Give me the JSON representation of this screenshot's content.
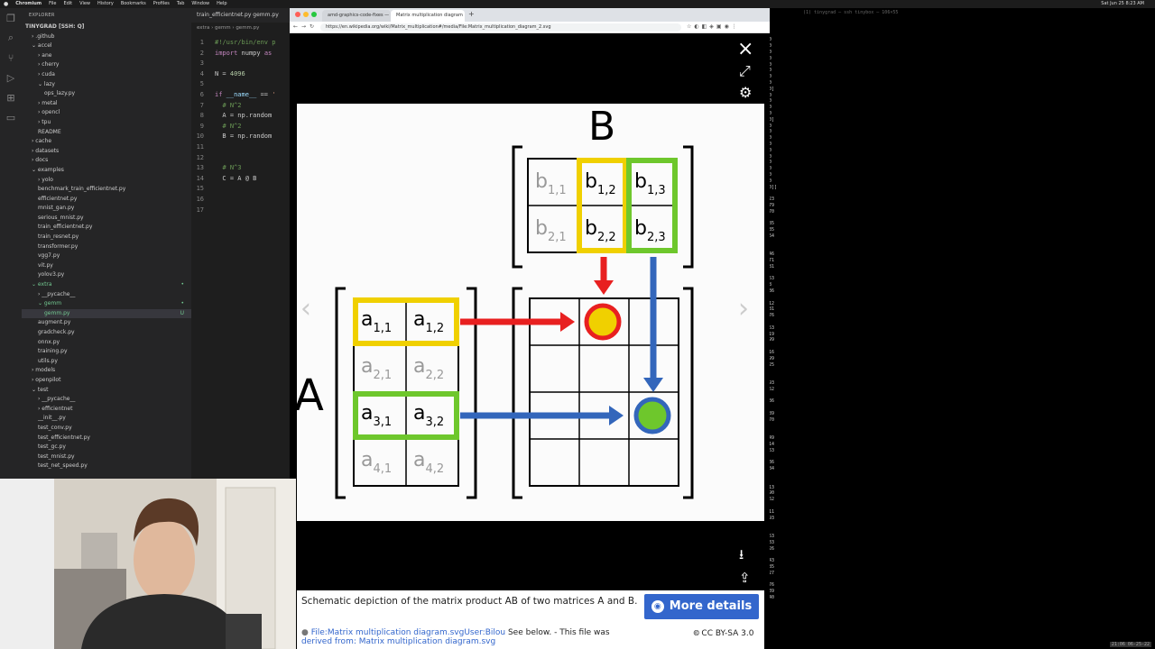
{
  "menubar": {
    "apple": "",
    "items": [
      "Chromium",
      "File",
      "Edit",
      "View",
      "History",
      "Bookmarks",
      "Profiles",
      "Tab",
      "Window",
      "Help"
    ],
    "clock": "Sat Jun 25  8:23 AM"
  },
  "explorer": {
    "header": "EXPLORER",
    "root": "TINYGRAD [SSH: Q]",
    "items": [
      {
        "label": "› .github",
        "d": 1
      },
      {
        "label": "⌄ accel",
        "d": 1
      },
      {
        "label": "› ane",
        "d": 2
      },
      {
        "label": "› cherry",
        "d": 2
      },
      {
        "label": "› cuda",
        "d": 2
      },
      {
        "label": "⌄ lazy",
        "d": 2
      },
      {
        "label": "ops_lazy.py",
        "d": 3
      },
      {
        "label": "› metal",
        "d": 2
      },
      {
        "label": "› opencl",
        "d": 2
      },
      {
        "label": "› tpu",
        "d": 2
      },
      {
        "label": "README",
        "d": 2
      },
      {
        "label": "› cache",
        "d": 1
      },
      {
        "label": "› datasets",
        "d": 1
      },
      {
        "label": "› docs",
        "d": 1
      },
      {
        "label": "⌄ examples",
        "d": 1
      },
      {
        "label": "› yolo",
        "d": 2
      },
      {
        "label": "benchmark_train_efficientnet.py",
        "d": 2
      },
      {
        "label": "efficientnet.py",
        "d": 2
      },
      {
        "label": "mnist_gan.py",
        "d": 2
      },
      {
        "label": "serious_mnist.py",
        "d": 2
      },
      {
        "label": "train_efficientnet.py",
        "d": 2
      },
      {
        "label": "train_resnet.py",
        "d": 2
      },
      {
        "label": "transformer.py",
        "d": 2
      },
      {
        "label": "vgg7.py",
        "d": 2
      },
      {
        "label": "vit.py",
        "d": 2
      },
      {
        "label": "yolov3.py",
        "d": 2
      },
      {
        "label": "⌄ extra",
        "d": 1,
        "badge": "•"
      },
      {
        "label": "› __pycache__",
        "d": 2
      },
      {
        "label": "⌄ gemm",
        "d": 2,
        "badge": "•"
      },
      {
        "label": "gemm.py",
        "d": 3,
        "badge": "U",
        "sel": true
      },
      {
        "label": "augment.py",
        "d": 2
      },
      {
        "label": "gradcheck.py",
        "d": 2
      },
      {
        "label": "onnx.py",
        "d": 2
      },
      {
        "label": "training.py",
        "d": 2
      },
      {
        "label": "utils.py",
        "d": 2
      },
      {
        "label": "› models",
        "d": 1
      },
      {
        "label": "› openpilot",
        "d": 1
      },
      {
        "label": "⌄ test",
        "d": 1
      },
      {
        "label": "› __pycache__",
        "d": 2
      },
      {
        "label": "› efficientnet",
        "d": 2
      },
      {
        "label": "__init__.py",
        "d": 2
      },
      {
        "label": "test_conv.py",
        "d": 2
      },
      {
        "label": "test_efficientnet.py",
        "d": 2
      },
      {
        "label": "test_gc.py",
        "d": 2
      },
      {
        "label": "test_mnist.py",
        "d": 2
      },
      {
        "label": "test_net_speed.py",
        "d": 2
      }
    ]
  },
  "editor": {
    "tabs": "train_efficientnet.py   gemm.py",
    "breadcrumb": "extra › gemm › gemm.py",
    "lines": [
      {
        "n": "1",
        "html": "<span class='cm'>#!/usr/bin/env p</span>"
      },
      {
        "n": "2",
        "html": "<span class='kw'>import</span> numpy <span class='kw'>as</span>"
      },
      {
        "n": "3",
        "html": ""
      },
      {
        "n": "4",
        "html": "N = <span class='num'>4096</span>"
      },
      {
        "n": "5",
        "html": ""
      },
      {
        "n": "6",
        "html": "<span class='kw'>if</span> <span class='fn'>__name__</span> == <span class='st'>'</span>"
      },
      {
        "n": "7",
        "html": "  <span class='cm'># N^2</span>"
      },
      {
        "n": "8",
        "html": "  A = np.random"
      },
      {
        "n": "9",
        "html": "  <span class='cm'># N^2</span>"
      },
      {
        "n": "10",
        "html": "  B = np.random"
      },
      {
        "n": "11",
        "html": ""
      },
      {
        "n": "12",
        "html": ""
      },
      {
        "n": "13",
        "html": "  <span class='cm'># N^3</span>"
      },
      {
        "n": "14",
        "html": "  C = A @ B"
      },
      {
        "n": "15",
        "html": ""
      },
      {
        "n": "16",
        "html": ""
      },
      {
        "n": "17",
        "html": ""
      }
    ]
  },
  "terminal": {
    "title": "(1) tinygrad — ssh tinybox — 106×55",
    "status": "21:06  06-25-22",
    "rows": [
      "",
      "",
      "",
      "0",
      "0",
      "0",
      "0",
      "0",
      "0",
      "0",
      "0",
      "0]",
      "0",
      "0",
      "0",
      "0",
      "0]",
      "0",
      "0",
      "0",
      "0",
      "0",
      "0",
      "0",
      "0",
      "0",
      "0",
      "0]]",
      "",
      "23",
      "79",
      "70",
      "",
      "85",
      "35",
      "64",
      "",
      "",
      "46",
      "71",
      "81",
      "",
      "53",
      "8",
      "36",
      "",
      "12",
      "81",
      "76",
      "",
      "53",
      "19",
      "99",
      "",
      "16",
      "99",
      "25",
      "",
      "",
      "93",
      "52",
      "",
      "36",
      "",
      "89",
      "70",
      "",
      "",
      "49",
      "14",
      "63",
      "",
      "36",
      "84",
      "",
      "",
      "13",
      "90",
      "62",
      "",
      "11",
      "93",
      "",
      "",
      "53",
      "33",
      "26",
      "",
      "43",
      "85",
      "27",
      "",
      "76",
      "39",
      "40"
    ]
  },
  "chrome": {
    "tabs": [
      "amd-graphics-code-fixes — G",
      "Matrix multiplication diagram"
    ],
    "url": "https://en.wikipedia.org/wiki/Matrix_multiplication#/media/File:Matrix_multiplication_diagram_2.svg"
  },
  "lightbox": {
    "close_icon": "×",
    "expand_icon": "⤢",
    "settings_icon": "⚙",
    "prev_icon": "‹",
    "next_icon": "›",
    "download_icon": "⭳",
    "share_icon": "⇪",
    "caption": "Schematic depiction of the matrix product AB of two matrices A and B.",
    "more_details": "More details",
    "file_link": "File:Matrix multiplication diagram.svg",
    "user_link": "User:Bilou",
    "file_note": " See below. - This file was",
    "file_note2": "derived from: Matrix multiplication diagram.svg",
    "license": "CC BY-SA 3.0"
  },
  "diagram": {
    "label_A": "A",
    "label_B": "B",
    "colors": {
      "yellow": "#f0d000",
      "green": "#6ec72c",
      "red": "#e82020",
      "blue": "#3366bb",
      "grid": "#000000",
      "gray": "#999999"
    },
    "B_cells": [
      [
        "b",
        "1,1",
        false
      ],
      [
        "b",
        "1,2",
        true
      ],
      [
        "b",
        "1,3",
        true
      ],
      [
        "b",
        "2,1",
        false
      ],
      [
        "b",
        "2,2",
        true
      ],
      [
        "b",
        "2,3",
        true
      ]
    ],
    "A_cells": [
      [
        "a",
        "1,1",
        true
      ],
      [
        "a",
        "1,2",
        true
      ],
      [
        "a",
        "2,1",
        false
      ],
      [
        "a",
        "2,2",
        false
      ],
      [
        "a",
        "3,1",
        true
      ],
      [
        "a",
        "3,2",
        true
      ],
      [
        "a",
        "4,1",
        false
      ],
      [
        "a",
        "4,2",
        false
      ]
    ]
  }
}
